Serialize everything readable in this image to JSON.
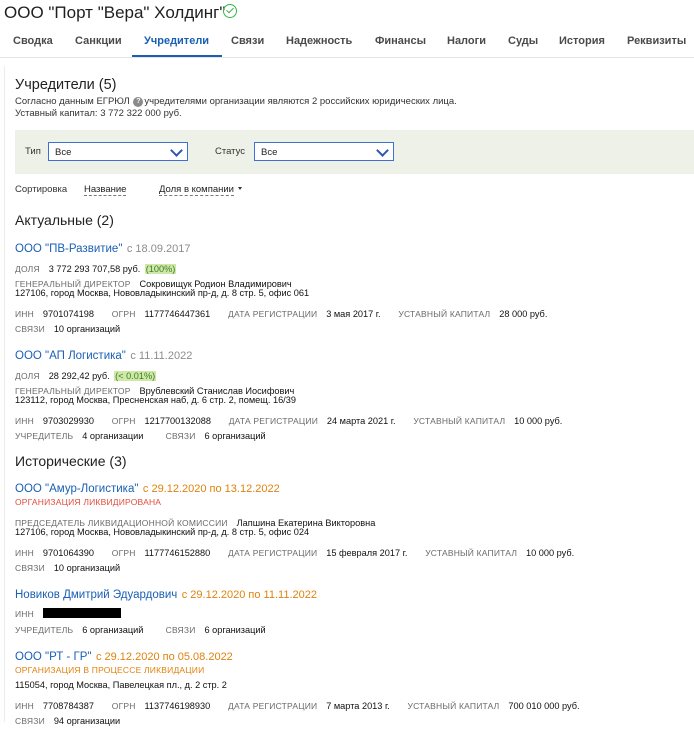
{
  "header": {
    "company_name": "ООО \"Порт \"Вера\" Холдинг\""
  },
  "tabs": [
    "Сводка",
    "Санкции",
    "Учредители",
    "Связи",
    "Надежность",
    "Финансы",
    "Налоги",
    "Суды",
    "История",
    "Реквизиты"
  ],
  "section": {
    "title": "Учредители (5)",
    "desc_before": "Согласно данным ЕГРЮЛ",
    "desc_after": "учредителями организации являются 2 российских юридических лица.",
    "capital": "Уставный капитал: 3 772 322 000 руб."
  },
  "filters": {
    "type_label": "Тип",
    "type_value": "Все",
    "status_label": "Статус",
    "status_value": "Все"
  },
  "sort": {
    "label": "Сортировка",
    "by_name": "Название",
    "by_share": "Доля в компании"
  },
  "groups": {
    "actual": "Актуальные (2)",
    "historical": "Исторические (3)"
  },
  "labels": {
    "share": "ДОЛЯ",
    "gen_dir": "ГЕНЕРАЛЬНЫЙ ДИРЕКТОР",
    "inn": "ИНН",
    "ogrn": "ОГРН",
    "reg_date": "ДАТА РЕГИСТРАЦИИ",
    "capital": "УСТАВНЫЙ КАПИТАЛ",
    "links": "СВЯЗИ",
    "founder": "УЧРЕДИТЕЛЬ",
    "liq_chair": "ПРЕДСЕДАТЕЛЬ ЛИКВИДАЦИОННОЙ КОМИССИИ"
  },
  "org1": {
    "name": "ООО \"ПВ-Развитие\"",
    "since": "с 18.09.2017",
    "share": "3 772 293 707,58 руб.",
    "share_pct": "(100%)",
    "director": "Сокровищук Родион Владимирович",
    "address": "127106, город Москва, Нововладыкинский пр-д, д. 8 стр. 5, офис 061",
    "inn": "9701074198",
    "ogrn": "1177746447361",
    "reg_date": "3 мая 2017 г.",
    "capital": "28 000 руб.",
    "links": "10 организаций"
  },
  "org2": {
    "name": "ООО \"АП Логистика\"",
    "since": "с 11.11.2022",
    "share": "28 292,42 руб.",
    "share_pct": "(< 0.01%)",
    "director": "Врублевский Станислав Иосифович",
    "address": "123112, город Москва, Пресненская наб, д. 6 стр. 2, помещ. 16/39",
    "inn": "9703029930",
    "ogrn": "1217700132088",
    "reg_date": "24 марта 2021 г.",
    "capital": "10 000 руб.",
    "founder": "4 организации",
    "links": "6 организаций"
  },
  "org3": {
    "name": "ООО \"Амур-Логистика\"",
    "period": "с 29.12.2020 по 13.12.2022",
    "status": "ОРГАНИЗАЦИЯ ЛИКВИДИРОВАНА",
    "chair": "Лапшина Екатерина Викторовна",
    "address": "127106, город Москва, Нововладыкинский пр-д, д. 8 стр. 5, офис 024",
    "inn": "9701064390",
    "ogrn": "1177746152880",
    "reg_date": "15 февраля 2017 г.",
    "capital": "10 000 руб.",
    "links": "10 организаций"
  },
  "person": {
    "name": "Новиков Дмитрий Эдуардович",
    "period": "с 29.12.2020 по 11.11.2022",
    "founder": "6 организаций",
    "links": "6 организаций"
  },
  "org4": {
    "name": "ООО \"РТ - ГР\"",
    "period": "с 29.12.2020 по 05.08.2022",
    "status": "ОРГАНИЗАЦИЯ В ПРОЦЕССЕ ЛИКВИДАЦИИ",
    "address": "115054, город Москва, Павелецкая пл., д. 2 стр. 2",
    "inn": "7708784387",
    "ogrn": "1137746198930",
    "reg_date": "7 марта 2013 г.",
    "capital": "700 010 000 руб.",
    "links": "94 организации"
  }
}
